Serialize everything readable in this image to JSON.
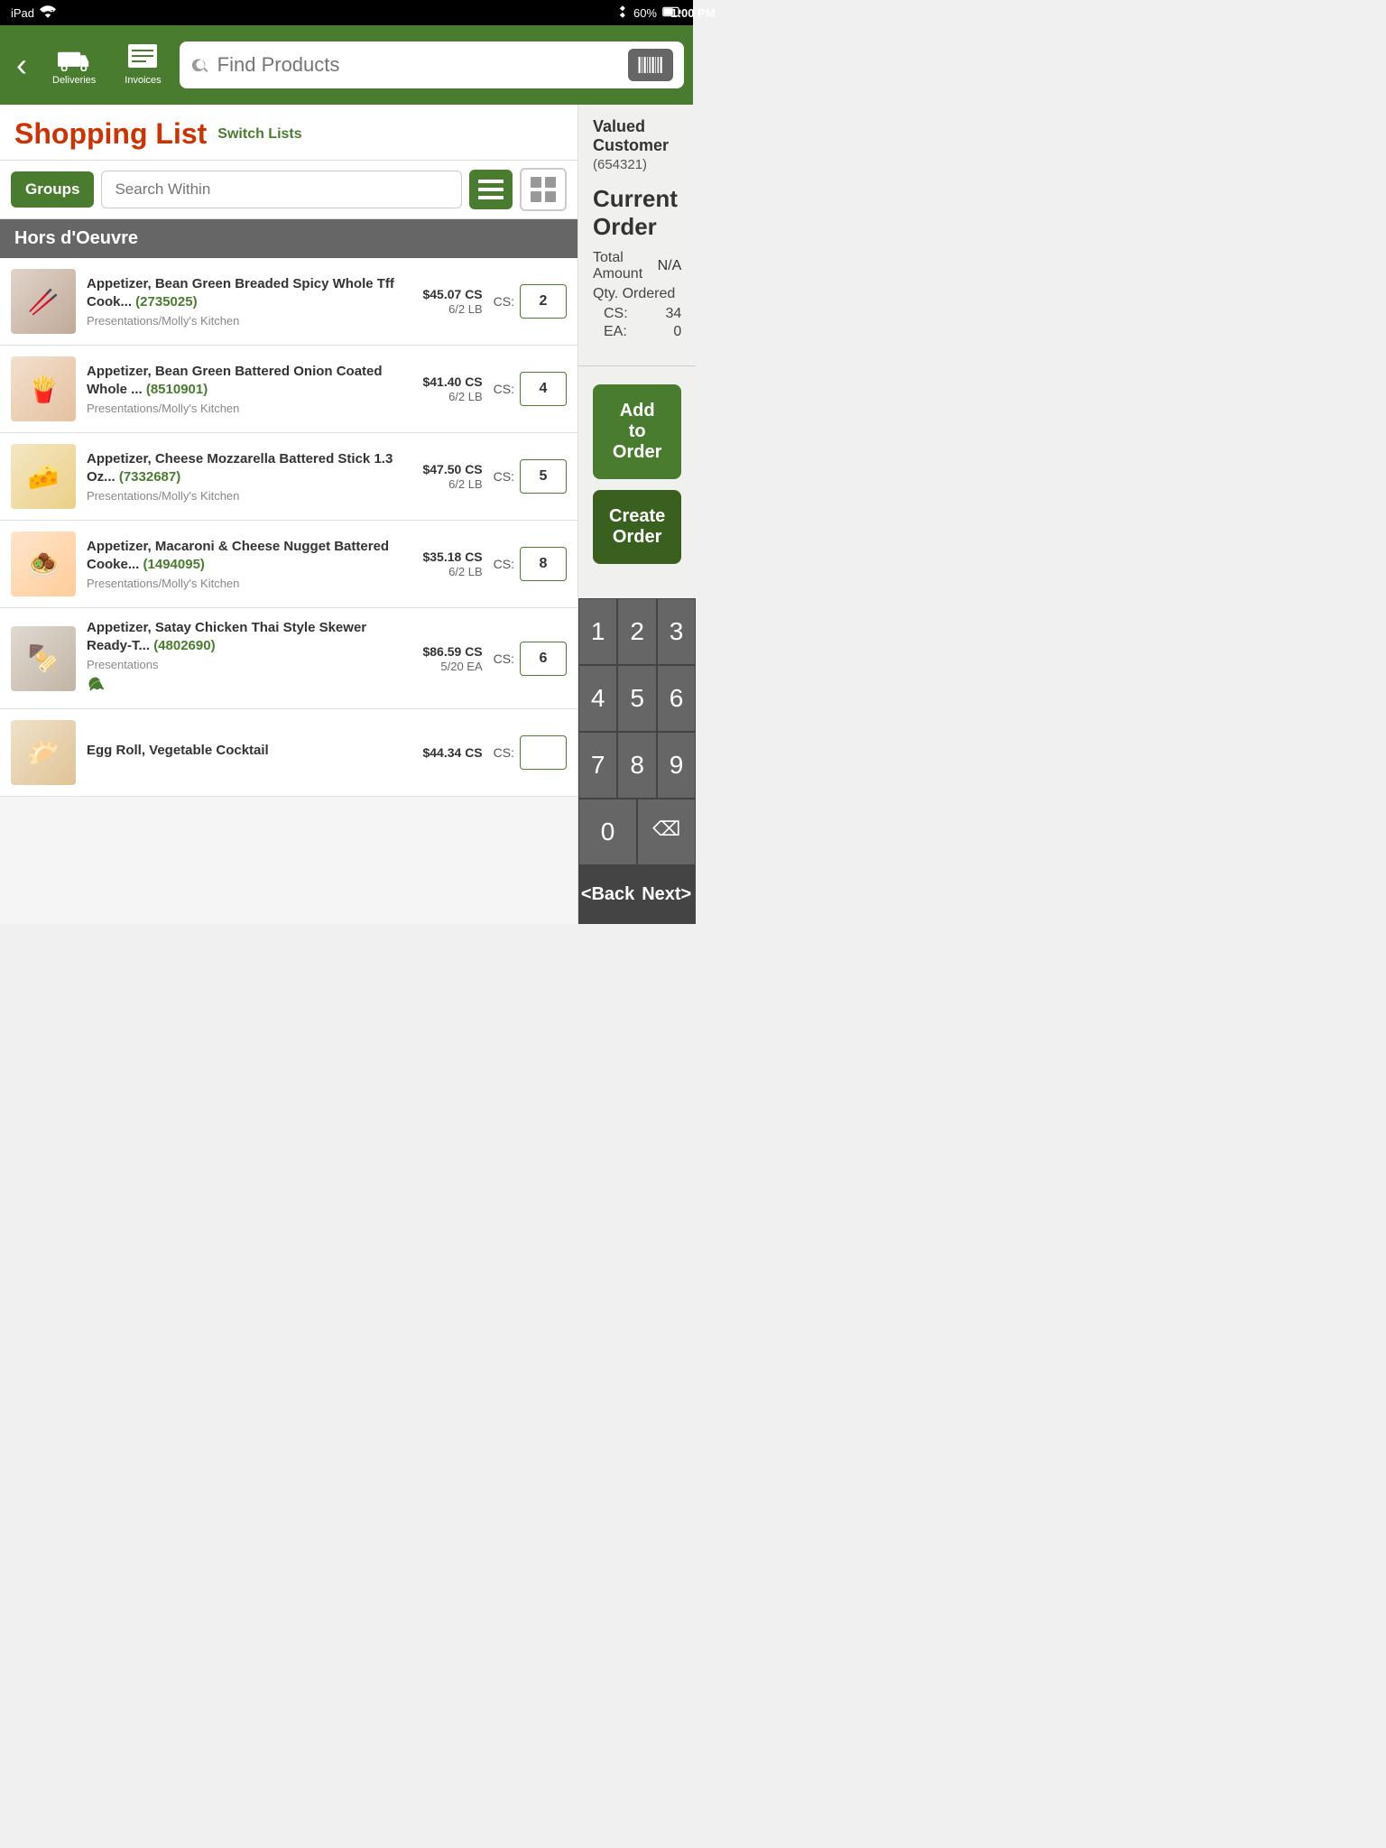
{
  "status_bar": {
    "left": "iPad",
    "wifi_icon": "wifi",
    "time": "1:00 PM",
    "bluetooth_icon": "bluetooth",
    "battery": "60%"
  },
  "nav": {
    "back_label": "‹",
    "deliveries_label": "Deliveries",
    "invoices_label": "Invoices",
    "search_placeholder": "Find Products",
    "barcode_icon": "barcode"
  },
  "shopping_list": {
    "title": "Shopping List",
    "switch_lists_label": "Switch Lists",
    "groups_label": "Groups",
    "search_within_placeholder": "Search Within"
  },
  "group": {
    "name": "Hors d'Oeuvre"
  },
  "products": [
    {
      "id": 1,
      "name": "Appetizer, Bean Green Breaded Spicy Whole Tff Cook...",
      "product_id": "2735025",
      "brand": "Presentations/Molly's Kitchen",
      "price": "$45.07 CS",
      "unit": "6/2 LB",
      "qty_label": "CS:",
      "qty": "2",
      "has_eco": false,
      "color": "#8B4513",
      "emoji": "🥢"
    },
    {
      "id": 2,
      "name": "Appetizer, Bean Green Battered Onion Coated Whole ...",
      "product_id": "8510901",
      "brand": "Presentations/Molly's Kitchen",
      "price": "$41.40 CS",
      "unit": "6/2 LB",
      "qty_label": "CS:",
      "qty": "4",
      "has_eco": false,
      "color": "#D2691E",
      "emoji": "🍟"
    },
    {
      "id": 3,
      "name": "Appetizer, Cheese Mozzarella Battered Stick 1.3 Oz...",
      "product_id": "7332687",
      "brand": "Presentations/Molly's Kitchen",
      "price": "$47.50 CS",
      "unit": "6/2 LB",
      "qty_label": "CS:",
      "qty": "5",
      "has_eco": false,
      "color": "#DAA520",
      "emoji": "🧀"
    },
    {
      "id": 4,
      "name": "Appetizer, Macaroni & Cheese Nugget Battered Cooke...",
      "product_id": "1494095",
      "brand": "Presentations/Molly's Kitchen",
      "price": "$35.18 CS",
      "unit": "6/2 LB",
      "qty_label": "CS:",
      "qty": "8",
      "has_eco": false,
      "color": "#FFA500",
      "emoji": "🧆"
    },
    {
      "id": 5,
      "name": "Appetizer, Satay Chicken Thai Style Skewer Ready-T...",
      "product_id": "4802690",
      "brand": "Presentations",
      "price": "$86.59 CS",
      "unit": "5/20 EA",
      "qty_label": "CS:",
      "qty": "6",
      "has_eco": true,
      "color": "#8B6914",
      "emoji": "🍢"
    },
    {
      "id": 6,
      "name": "Egg Roll, Vegetable Cocktail",
      "product_id": "",
      "brand": "",
      "price": "$44.34 CS",
      "unit": "",
      "qty_label": "CS:",
      "qty": "",
      "has_eco": false,
      "color": "#CD853F",
      "emoji": "🥟"
    }
  ],
  "current_order": {
    "title": "Current Order",
    "customer_name": "Valued Customer",
    "customer_id": "(654321)",
    "total_amount_label": "Total Amount",
    "total_amount_value": "N/A",
    "qty_ordered_label": "Qty. Ordered",
    "cs_label": "CS:",
    "cs_value": "34",
    "ea_label": "EA:",
    "ea_value": "0",
    "add_to_order_label": "Add to Order",
    "create_order_label": "Create Order"
  },
  "numpad": {
    "keys": [
      "1",
      "2",
      "3",
      "4",
      "5",
      "6",
      "7",
      "8",
      "9",
      "0",
      "⌫"
    ],
    "back_label": "<Back",
    "next_label": "Next>"
  }
}
